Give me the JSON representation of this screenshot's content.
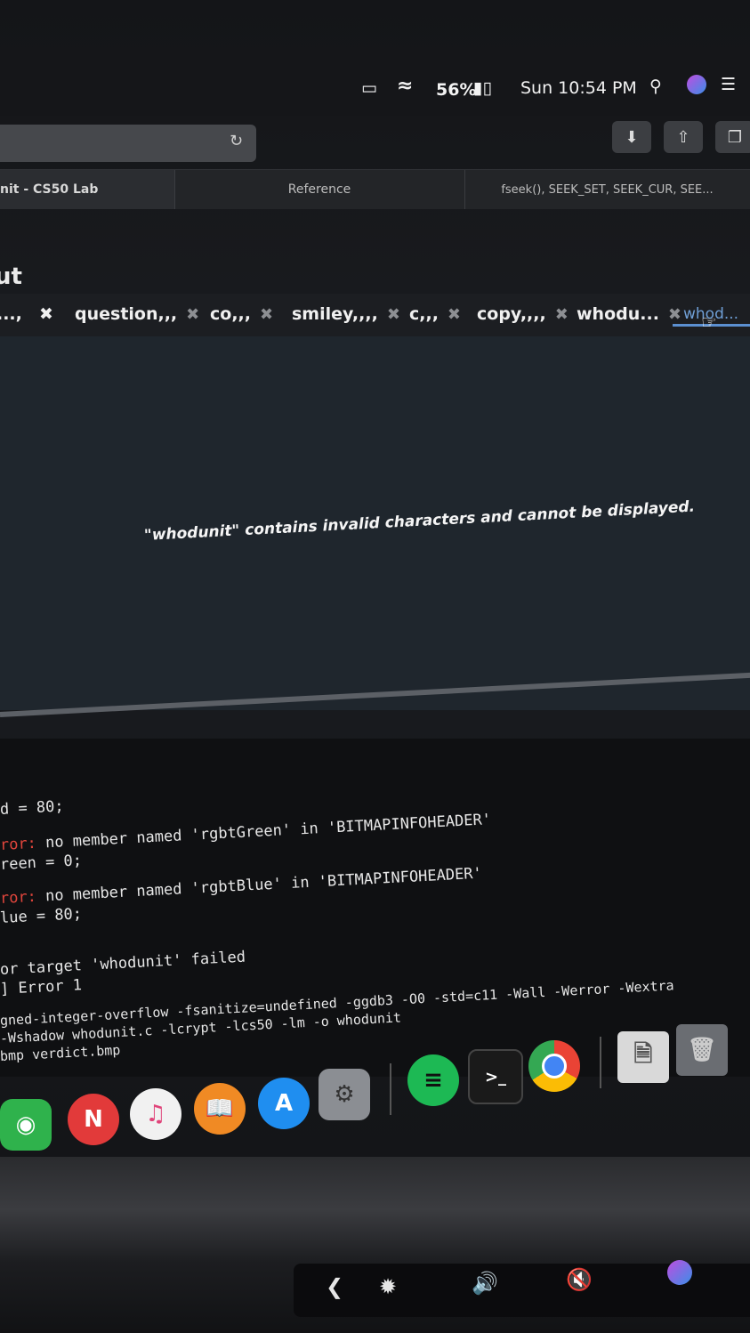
{
  "menubar": {
    "battery_percent": "56%",
    "clock": "Sun 10:54 PM"
  },
  "browser_tabs": [
    {
      "label": "nit - CS50 Lab"
    },
    {
      "label": "Reference"
    },
    {
      "label": "fseek(), SEEK_SET, SEEK_CUR, SEE..."
    }
  ],
  "ide": {
    "panel_title": "ut",
    "editor_tabs": [
      {
        "label": "...,"
      },
      {
        "label": "question,,,"
      },
      {
        "label": "co,,,"
      },
      {
        "label": "smiley,,,,"
      },
      {
        "label": "c,,,"
      },
      {
        "label": "copy,,,,"
      },
      {
        "label": "whodu..."
      },
      {
        "label": "whod..."
      }
    ],
    "message": "\"whodunit\" contains invalid characters and cannot be displayed."
  },
  "terminal": {
    "lines": [
      {
        "prefix": "",
        "text": "d = 80;"
      },
      {
        "prefix": "ror:",
        "text": " no member named 'rgbtGreen' in 'BITMAPINFOHEADER'"
      },
      {
        "prefix": "",
        "text": "reen = 0;"
      },
      {
        "prefix": "ror:",
        "text": " no member named 'rgbtBlue' in 'BITMAPINFOHEADER'"
      },
      {
        "prefix": "",
        "text": "lue = 80;"
      },
      {
        "prefix": "",
        "text": "or target 'whodunit' failed"
      },
      {
        "prefix": "",
        "text": "] Error 1"
      },
      {
        "prefix": "",
        "text": "gned-integer-overflow -fsanitize=undefined -ggdb3 -O0 -std=c11 -Wall -Werror -Wextra"
      },
      {
        "prefix": "",
        "text": "-Wshadow    whodunit.c  -lcrypt -lcs50 -lm -o whodunit"
      },
      {
        "prefix": "",
        "text": "bmp verdict.bmp"
      }
    ]
  },
  "colors": {
    "editor_bg": "#1f262d",
    "terminal_error": "#e0453c",
    "active_tab": "#6f9fd6"
  }
}
